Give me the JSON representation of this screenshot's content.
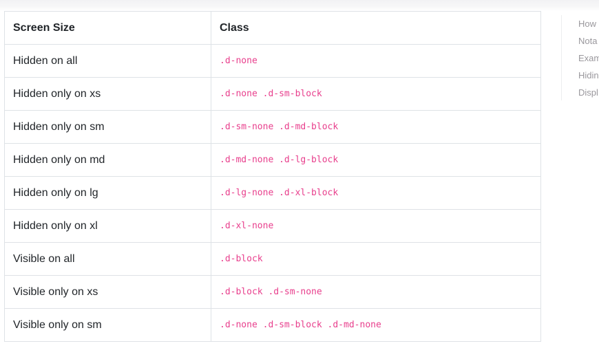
{
  "table": {
    "headers": [
      "Screen Size",
      "Class"
    ],
    "rows": [
      {
        "size": "Hidden on all",
        "class": ".d-none"
      },
      {
        "size": "Hidden only on xs",
        "class": ".d-none .d-sm-block"
      },
      {
        "size": "Hidden only on sm",
        "class": ".d-sm-none .d-md-block"
      },
      {
        "size": "Hidden only on md",
        "class": ".d-md-none .d-lg-block"
      },
      {
        "size": "Hidden only on lg",
        "class": ".d-lg-none .d-xl-block"
      },
      {
        "size": "Hidden only on xl",
        "class": ".d-xl-none"
      },
      {
        "size": "Visible on all",
        "class": ".d-block"
      },
      {
        "size": "Visible only on xs",
        "class": ".d-block .d-sm-none"
      },
      {
        "size": "Visible only on sm",
        "class": ".d-none .d-sm-block .d-md-none"
      }
    ]
  },
  "toc": {
    "items": [
      "How",
      "Nota",
      "Exam",
      "Hidin",
      "Displ"
    ]
  },
  "colors": {
    "code": "#e83e8c",
    "border": "#dee2e6",
    "toc_text": "#99979c"
  }
}
